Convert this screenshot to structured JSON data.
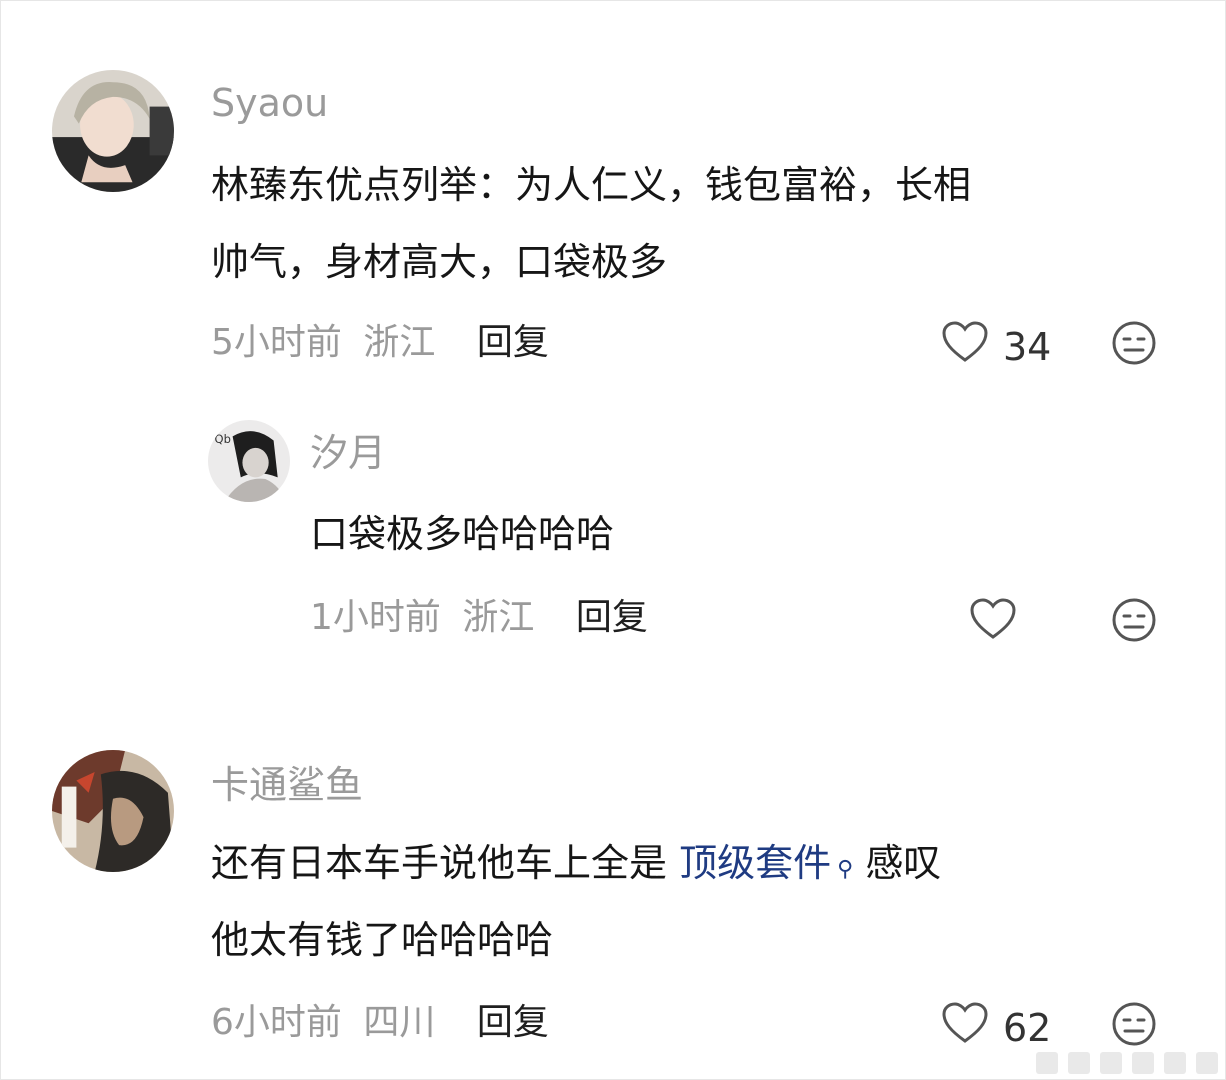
{
  "comments": [
    {
      "user": "Syaou",
      "lines": [
        "林臻东优点列举：为人仁义，钱包富裕，长相",
        "帅气，身材高大，口袋极多"
      ],
      "time": "5小时前",
      "location": "浙江",
      "reply_label": "回复",
      "likes": "34",
      "avatar_icon": "user-avatar-photo",
      "reply": {
        "user": "汐月",
        "lines": [
          "口袋极多哈哈哈哈"
        ],
        "time": "1小时前",
        "location": "浙江",
        "reply_label": "回复",
        "likes": "",
        "avatar_icon": "user-avatar-photo"
      }
    },
    {
      "user": "卡通鲨鱼",
      "line1_before": "还有日本车手说他车上全是 ",
      "link_text": "顶级套件",
      "line1_after": " 感叹",
      "line2": "他太有钱了哈哈哈哈",
      "time": "6小时前",
      "location": "四川",
      "reply_label": "回复",
      "likes": "62",
      "avatar_icon": "user-avatar-illustration",
      "link_icon": "search-icon"
    }
  ],
  "icons": {
    "like": "heart-outline-icon",
    "dislike": "meh-face-icon"
  },
  "colors": {
    "username": "#9a9a9a",
    "link": "#1f3b82",
    "icon": "#555555"
  }
}
